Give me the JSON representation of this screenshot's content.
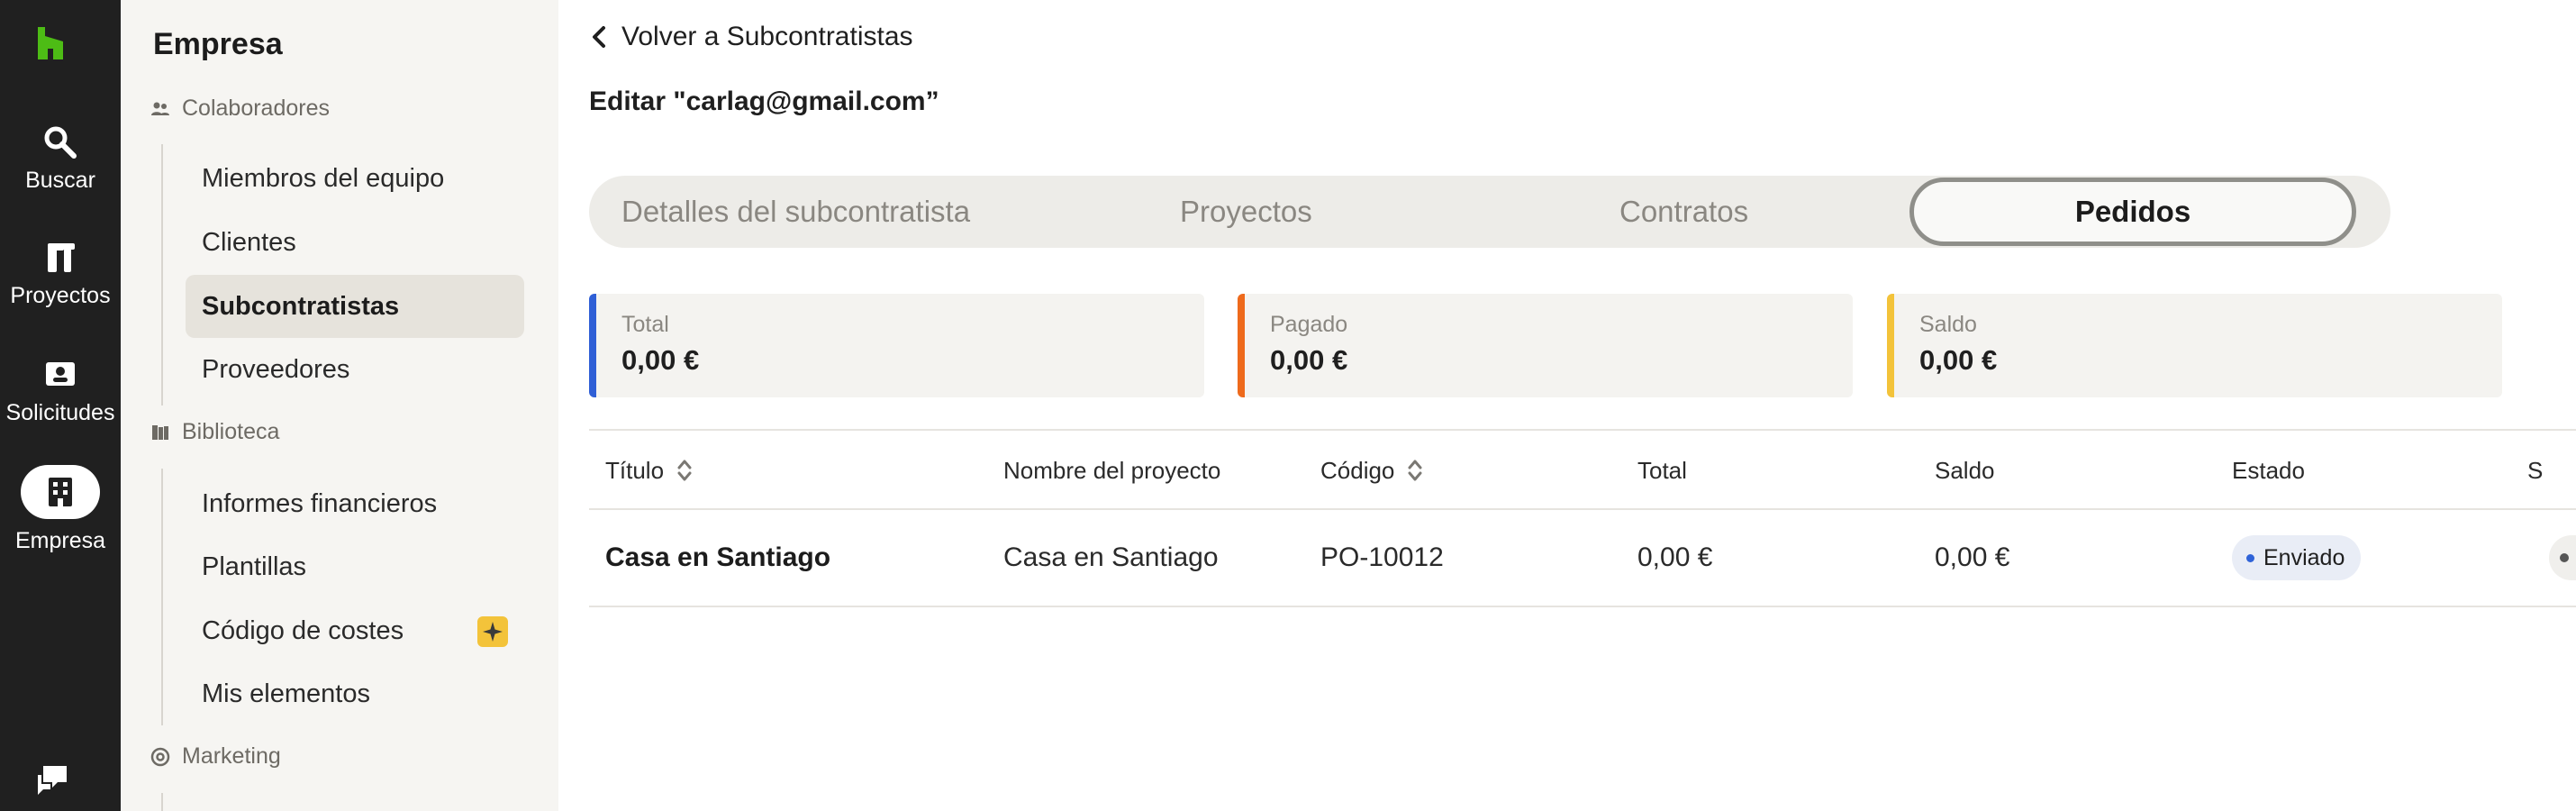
{
  "rail": {
    "items": [
      {
        "label": "Buscar",
        "icon": "search-icon"
      },
      {
        "label": "Proyectos",
        "icon": "tools-icon"
      },
      {
        "label": "Solicitudes",
        "icon": "inbox-user-icon"
      },
      {
        "label": "Empresa",
        "icon": "building-icon",
        "active": true
      }
    ],
    "logo": "houzz-logo-icon",
    "chat": "chat-icon"
  },
  "sidebar": {
    "title": "Empresa",
    "sections": {
      "colaboradores": "Colaboradores",
      "biblioteca": "Biblioteca",
      "marketing": "Marketing"
    },
    "colaboradores_items": [
      "Miembros del equipo",
      "Clientes",
      "Subcontratistas",
      "Proveedores"
    ],
    "biblioteca_items": [
      "Informes financieros",
      "Plantillas",
      "Código de costes",
      "Mis elementos"
    ],
    "active_item": "Subcontratistas"
  },
  "main": {
    "back_label": "Volver a Subcontratistas",
    "edit_title": "Editar \"carlag@gmail.com”",
    "tabs": [
      "Detalles del subcontratista",
      "Proyectos",
      "Contratos",
      "Pedidos"
    ],
    "active_tab": "Pedidos",
    "summary": [
      {
        "label": "Total",
        "value": "0,00 €",
        "color": "#2f5fd6"
      },
      {
        "label": "Pagado",
        "value": "0,00 €",
        "color": "#ee6a1c"
      },
      {
        "label": "Saldo",
        "value": "0,00 €",
        "color": "#f3c33a"
      }
    ],
    "table": {
      "headers": [
        "Título",
        "Nombre del proyecto",
        "Código",
        "Total",
        "Saldo",
        "Estado",
        "S"
      ],
      "rows": [
        {
          "titulo": "Casa en Santiago",
          "proyecto": "Casa en Santiago",
          "codigo": "PO-10012",
          "total": "0,00 €",
          "saldo": "0,00 €",
          "estado": "Enviado"
        }
      ]
    }
  },
  "colors": {
    "rail_bg": "#202020",
    "sidebar_bg": "#f6f5f2",
    "logo_green": "#4dbc15",
    "status_dot": "#2f63d8"
  }
}
